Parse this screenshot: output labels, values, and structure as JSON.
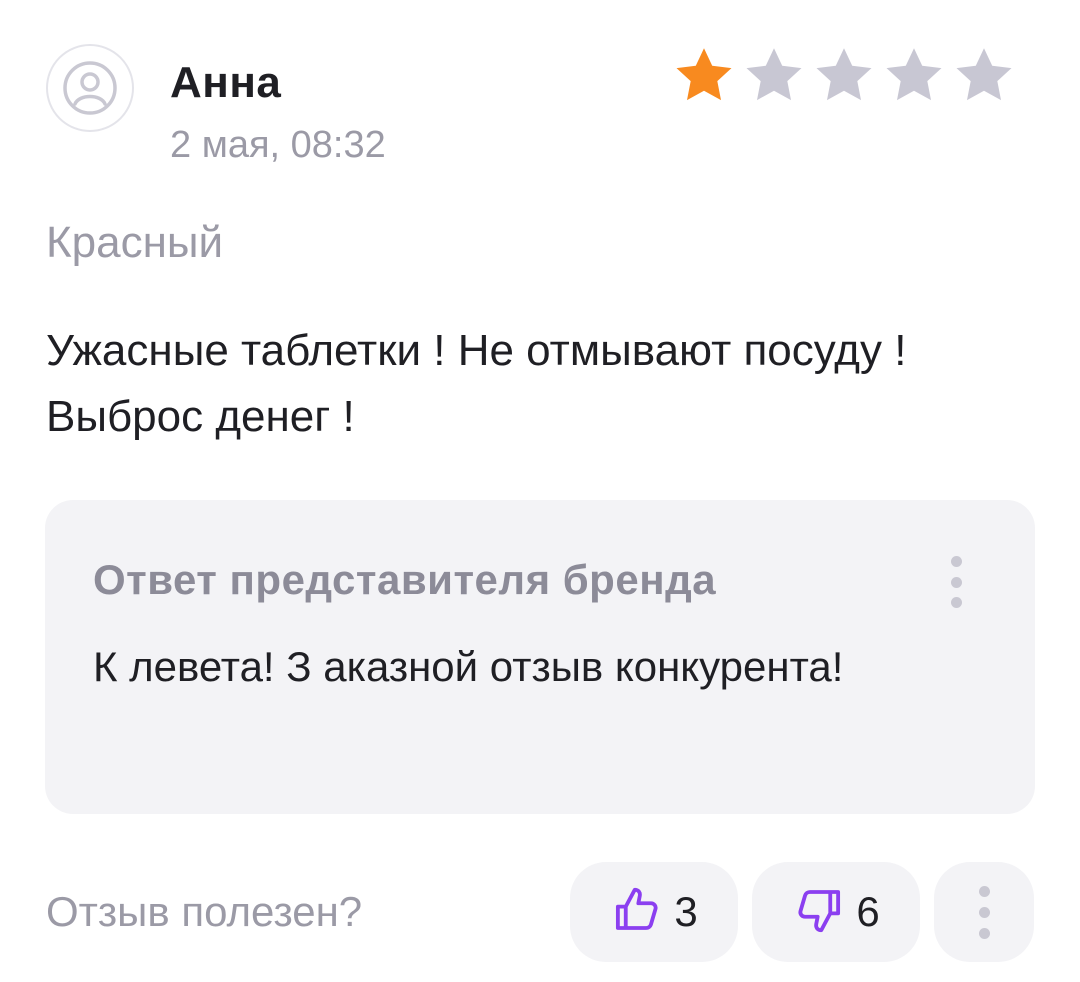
{
  "review": {
    "author": "Анна",
    "date": "2 мая, 08:32",
    "rating": 1,
    "rating_max": 5,
    "variant": "Красный",
    "text": "Ужасные таблетки ! Не отмывают посуду ! Выброс денег !"
  },
  "brand_reply": {
    "title": "Ответ представителя бренда",
    "text": "К левета! З аказной отзыв конкурента!"
  },
  "footer": {
    "helpful_label": "Отзыв полезен?",
    "likes": "3",
    "dislikes": "6"
  },
  "colors": {
    "star_active": "#f88a1f",
    "star_inactive": "#c8c7d3",
    "accent": "#8b3ff0",
    "panel_bg": "#f3f3f6"
  },
  "icons": {
    "avatar": "user-circle-icon",
    "like": "thumbs-up-icon",
    "dislike": "thumbs-down-icon",
    "menu": "vertical-dots-icon"
  }
}
